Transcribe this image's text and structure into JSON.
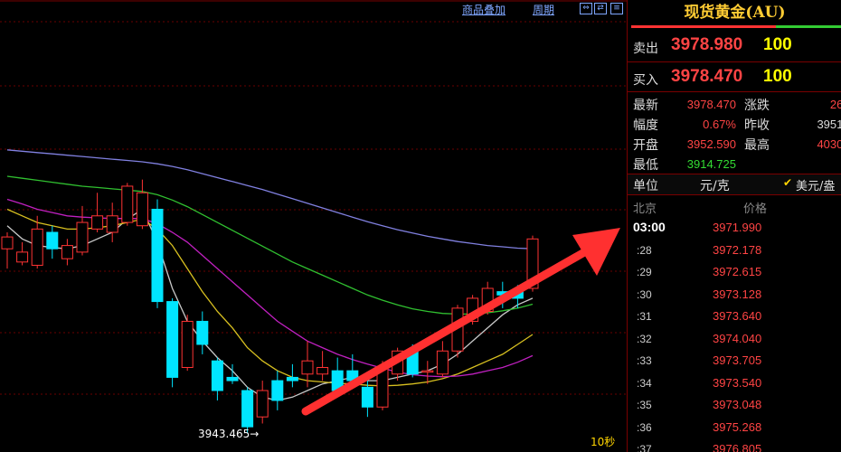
{
  "toolbar": {
    "overlay_label": "商品叠加",
    "period_label": "周期",
    "btn1": "⇔",
    "btn2": "⇄",
    "btn3": "≡"
  },
  "chart": {
    "low_label": "3943.465→",
    "interval_label": "10秒"
  },
  "colors": {
    "up": "#ff3333",
    "down": "#00e5ff",
    "ma1": "#c8c8c8",
    "ma2": "#d8c020",
    "ma3": "#c020c0",
    "ma4": "#30c030",
    "ma5": "#8080e0",
    "arrow": "#ff3030"
  },
  "chart_data": {
    "type": "candlestick",
    "y_range": [
      3935,
      4000
    ],
    "candles": [
      {
        "o": 3965.0,
        "c": 3966.8,
        "h": 3967.5,
        "l": 3962.0
      },
      {
        "o": 3963.0,
        "c": 3964.5,
        "h": 3966.0,
        "l": 3962.5
      },
      {
        "o": 3962.5,
        "c": 3968.0,
        "h": 3970.0,
        "l": 3962.0
      },
      {
        "o": 3967.5,
        "c": 3965.0,
        "h": 3968.5,
        "l": 3963.5
      },
      {
        "o": 3963.5,
        "c": 3965.5,
        "h": 3966.5,
        "l": 3962.5
      },
      {
        "o": 3964.5,
        "c": 3969.0,
        "h": 3971.5,
        "l": 3964.0
      },
      {
        "o": 3968.0,
        "c": 3970.0,
        "h": 3973.5,
        "l": 3967.5
      },
      {
        "o": 3967.5,
        "c": 3970.0,
        "h": 3972.0,
        "l": 3966.0
      },
      {
        "o": 3969.0,
        "c": 3974.5,
        "h": 3975.0,
        "l": 3968.5
      },
      {
        "o": 3968.5,
        "c": 3973.5,
        "h": 3975.5,
        "l": 3968.0
      },
      {
        "o": 3971.0,
        "c": 3957.0,
        "h": 3972.5,
        "l": 3956.0
      },
      {
        "o": 3957.0,
        "c": 3945.5,
        "h": 3957.5,
        "l": 3944.0
      },
      {
        "o": 3947.0,
        "c": 3954.0,
        "h": 3955.0,
        "l": 3946.5
      },
      {
        "o": 3954.0,
        "c": 3950.5,
        "h": 3955.5,
        "l": 3949.0
      },
      {
        "o": 3948.0,
        "c": 3943.5,
        "h": 3948.5,
        "l": 3942.0
      },
      {
        "o": 3945.5,
        "c": 3945.0,
        "h": 3947.5,
        "l": 3944.5
      },
      {
        "o": 3943.5,
        "c": 3938.0,
        "h": 3944.0,
        "l": 3937.0
      },
      {
        "o": 3939.5,
        "c": 3943.5,
        "h": 3945.0,
        "l": 3938.5
      },
      {
        "o": 3945.0,
        "c": 3942.0,
        "h": 3946.5,
        "l": 3940.5
      },
      {
        "o": 3945.5,
        "c": 3945.0,
        "h": 3947.5,
        "l": 3944.0
      },
      {
        "o": 3946.0,
        "c": 3948.0,
        "h": 3951.0,
        "l": 3944.0
      },
      {
        "o": 3946.0,
        "c": 3947.0,
        "h": 3949.5,
        "l": 3945.0
      },
      {
        "o": 3946.5,
        "c": 3943.5,
        "h": 3948.5,
        "l": 3943.0
      },
      {
        "o": 3946.5,
        "c": 3945.0,
        "h": 3949.0,
        "l": 3944.0
      },
      {
        "o": 3944.0,
        "c": 3941.0,
        "h": 3946.0,
        "l": 3939.5
      },
      {
        "o": 3941.0,
        "c": 3947.0,
        "h": 3948.0,
        "l": 3940.5
      },
      {
        "o": 3946.0,
        "c": 3949.5,
        "h": 3950.0,
        "l": 3945.0
      },
      {
        "o": 3949.5,
        "c": 3946.0,
        "h": 3950.5,
        "l": 3945.5
      },
      {
        "o": 3946.5,
        "c": 3946.5,
        "h": 3948.0,
        "l": 3944.5
      },
      {
        "o": 3946.0,
        "c": 3949.5,
        "h": 3951.0,
        "l": 3945.5
      },
      {
        "o": 3949.5,
        "c": 3956.0,
        "h": 3956.5,
        "l": 3948.5
      },
      {
        "o": 3954.0,
        "c": 3957.5,
        "h": 3958.0,
        "l": 3953.5
      },
      {
        "o": 3955.5,
        "c": 3959.0,
        "h": 3960.0,
        "l": 3955.0
      },
      {
        "o": 3958.5,
        "c": 3958.0,
        "h": 3960.0,
        "l": 3956.0
      },
      {
        "o": 3958.5,
        "c": 3957.5,
        "h": 3959.5,
        "l": 3956.0
      },
      {
        "o": 3959.0,
        "c": 3966.5,
        "h": 3967.0,
        "l": 3958.5
      }
    ],
    "moving_averages": [
      {
        "color_key": "ma1",
        "values": [
          3968.5,
          3966.5,
          3965.5,
          3965.2,
          3965.0,
          3965.5,
          3966.5,
          3967.5,
          3969.5,
          3971.0,
          3966.0,
          3959.0,
          3954.0,
          3951.0,
          3948.5,
          3946.5,
          3944.0,
          3942.5,
          3942.0,
          3942.5,
          3943.5,
          3944.5,
          3945.0,
          3945.5,
          3945.0,
          3945.0,
          3945.5,
          3946.0,
          3946.5,
          3947.5,
          3949.0,
          3951.0,
          3953.0,
          3955.0,
          3956.5,
          3957.5
        ]
      },
      {
        "color_key": "ma2",
        "values": [
          3971.0,
          3970.0,
          3969.0,
          3968.5,
          3968.0,
          3968.0,
          3968.2,
          3968.5,
          3969.0,
          3969.5,
          3968.0,
          3965.5,
          3962.0,
          3958.5,
          3955.5,
          3953.0,
          3950.0,
          3948.0,
          3946.5,
          3945.5,
          3945.0,
          3944.8,
          3944.6,
          3944.5,
          3944.3,
          3944.2,
          3944.3,
          3944.5,
          3944.8,
          3945.3,
          3946.0,
          3947.0,
          3948.0,
          3949.0,
          3950.5,
          3952.0
        ]
      },
      {
        "color_key": "ma3",
        "values": [
          3972.5,
          3971.8,
          3971.0,
          3970.5,
          3970.0,
          3969.8,
          3969.7,
          3969.6,
          3969.6,
          3969.6,
          3968.8,
          3967.5,
          3966.0,
          3964.0,
          3962.0,
          3960.0,
          3958.0,
          3956.0,
          3954.0,
          3952.5,
          3951.0,
          3950.0,
          3949.0,
          3948.2,
          3947.5,
          3946.9,
          3946.3,
          3945.9,
          3945.7,
          3945.6,
          3945.7,
          3946.0,
          3946.5,
          3947.0,
          3947.8,
          3948.8
        ]
      },
      {
        "color_key": "ma4",
        "values": [
          3976.0,
          3975.7,
          3975.4,
          3975.1,
          3974.8,
          3974.5,
          3974.3,
          3974.1,
          3973.9,
          3973.7,
          3973.2,
          3972.4,
          3971.4,
          3970.2,
          3969.0,
          3967.8,
          3966.6,
          3965.4,
          3964.2,
          3963.0,
          3962.0,
          3961.0,
          3960.0,
          3959.0,
          3958.0,
          3957.2,
          3956.5,
          3955.9,
          3955.5,
          3955.2,
          3955.1,
          3955.1,
          3955.3,
          3955.6,
          3956.0,
          3956.6
        ]
      },
      {
        "color_key": "ma5",
        "values": [
          3980.0,
          3979.8,
          3979.6,
          3979.4,
          3979.2,
          3979.0,
          3978.8,
          3978.6,
          3978.4,
          3978.2,
          3977.9,
          3977.5,
          3977.0,
          3976.4,
          3975.8,
          3975.2,
          3974.6,
          3974.0,
          3973.3,
          3972.6,
          3971.9,
          3971.2,
          3970.5,
          3969.8,
          3969.1,
          3968.5,
          3967.9,
          3967.4,
          3966.9,
          3966.5,
          3966.1,
          3965.8,
          3965.5,
          3965.3,
          3965.1,
          3965.0
        ]
      }
    ]
  },
  "panel": {
    "title": "现货黄金(AU)",
    "sell_label": "卖出",
    "sell_price": "3978.980",
    "sell_vol": "100",
    "buy_label": "买入",
    "buy_price": "3978.470",
    "buy_vol": "100",
    "stats": {
      "latest_label": "最新",
      "latest_value": "3978.470",
      "change_label": "涨跌",
      "change_value": "26.",
      "pct_label": "幅度",
      "pct_value": "0.67%",
      "prev_label": "昨收",
      "prev_value": "3951.",
      "open_label": "开盘",
      "open_value": "3952.590",
      "high_label": "最高",
      "high_value": "4030.",
      "low_label": "最低",
      "low_value": "3914.725"
    },
    "unit": {
      "label": "单位",
      "value": "元/克",
      "check": "✔",
      "alt": "美元/盎"
    },
    "ticks_header": {
      "city": "北京",
      "price": "价格"
    },
    "ticks": [
      {
        "time": "03:00",
        "price": "3971.990"
      },
      {
        "time": ":28",
        "price": "3972.178"
      },
      {
        "time": ":29",
        "price": "3972.615"
      },
      {
        "time": ":30",
        "price": "3973.128"
      },
      {
        "time": ":31",
        "price": "3973.640"
      },
      {
        "time": ":32",
        "price": "3974.040"
      },
      {
        "time": ":33",
        "price": "3973.705"
      },
      {
        "time": ":34",
        "price": "3973.540"
      },
      {
        "time": ":35",
        "price": "3973.048"
      },
      {
        "time": ":36",
        "price": "3975.268"
      },
      {
        "time": ":37",
        "price": "3976.805"
      }
    ]
  }
}
